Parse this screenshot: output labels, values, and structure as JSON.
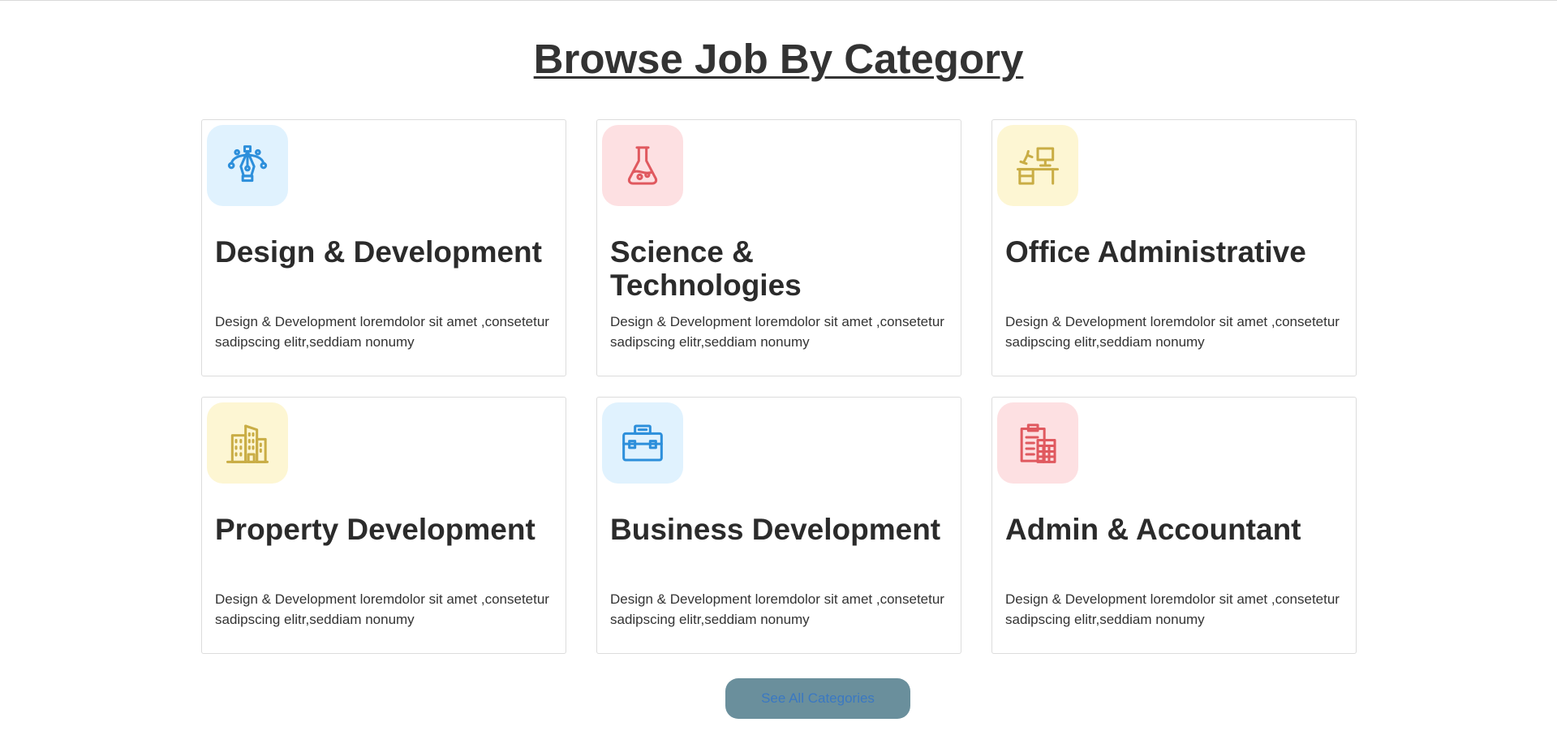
{
  "heading": "Browse Job By Category",
  "categories": [
    {
      "title": "Design & Development",
      "description": "Design & Development loremdolor sit amet ,consetetur sadipscing elitr,seddiam nonumy",
      "icon": "pen-tool-icon",
      "icon_bg": "#e0f2fe",
      "icon_color": "#2d8fdb"
    },
    {
      "title": "Science & Technologies",
      "description": "Design & Development loremdolor sit amet ,consetetur sadipscing elitr,seddiam nonumy",
      "icon": "flask-icon",
      "icon_bg": "#fde0e2",
      "icon_color": "#e0595f"
    },
    {
      "title": "Office Administrative",
      "description": "Design & Development loremdolor sit amet ,consetetur sadipscing elitr,seddiam nonumy",
      "icon": "office-desk-icon",
      "icon_bg": "#fdf6d3",
      "icon_color": "#c9ad45"
    },
    {
      "title": "Property Development",
      "description": "Design & Development loremdolor sit amet ,consetetur sadipscing elitr,seddiam nonumy",
      "icon": "buildings-icon",
      "icon_bg": "#fdf6d3",
      "icon_color": "#c9ad45"
    },
    {
      "title": "Business Development",
      "description": "Design & Development loremdolor sit amet ,consetetur sadipscing elitr,seddiam nonumy",
      "icon": "briefcase-icon",
      "icon_bg": "#e0f2fe",
      "icon_color": "#2d8fdb"
    },
    {
      "title": "Admin & Accountant",
      "description": "Design & Development loremdolor sit amet ,consetetur sadipscing elitr,seddiam nonumy",
      "icon": "clipboard-calculator-icon",
      "icon_bg": "#fde0e2",
      "icon_color": "#e0595f"
    }
  ],
  "see_all_button": {
    "label": "See All Categories",
    "bg": "#6a8f9c",
    "text_color": "#3a78c2"
  }
}
